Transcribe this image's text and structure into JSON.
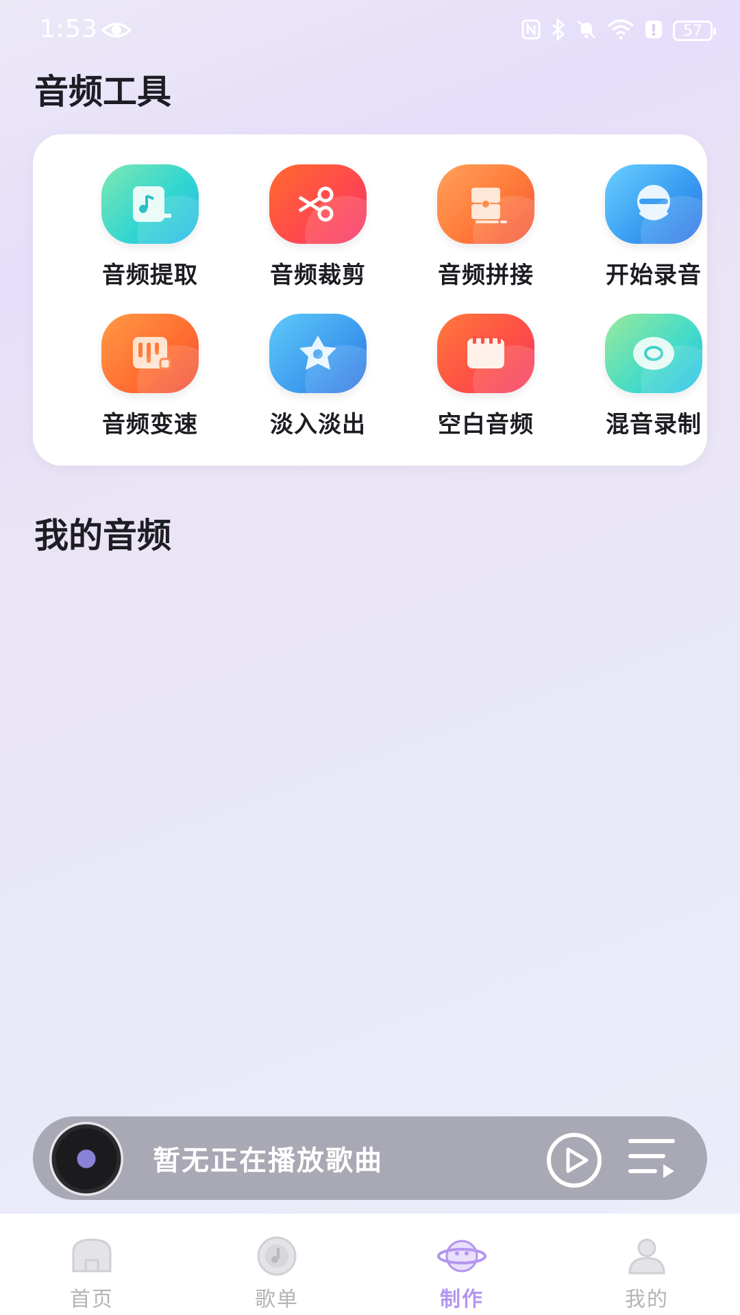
{
  "status_bar": {
    "time": "1:53",
    "battery": "57"
  },
  "tools_section": {
    "title": "音频工具",
    "items": [
      {
        "label": "音频提取",
        "icon": "music-file-icon"
      },
      {
        "label": "音频裁剪",
        "icon": "scissors-icon"
      },
      {
        "label": "音频拼接",
        "icon": "puzzle-icon"
      },
      {
        "label": "开始录音",
        "icon": "microphone-icon"
      },
      {
        "label": "音频变速",
        "icon": "equalizer-icon"
      },
      {
        "label": "淡入淡出",
        "icon": "star-icon"
      },
      {
        "label": "空白音频",
        "icon": "blank-card-icon"
      },
      {
        "label": "混音录制",
        "icon": "disc-icon"
      }
    ]
  },
  "my_audio_section": {
    "title": "我的音频"
  },
  "player": {
    "now_playing": "暂无正在播放歌曲"
  },
  "tabbar": {
    "tabs": [
      {
        "label": "首页",
        "icon": "home-icon",
        "active": false
      },
      {
        "label": "歌单",
        "icon": "playlist-disc-icon",
        "active": false
      },
      {
        "label": "制作",
        "icon": "planet-icon",
        "active": true
      },
      {
        "label": "我的",
        "icon": "user-icon",
        "active": false
      }
    ]
  },
  "colors": {
    "active_tab": "#b395f0",
    "inactive_tab": "#b3b3b8",
    "player_bg": "#a9a9b5"
  }
}
